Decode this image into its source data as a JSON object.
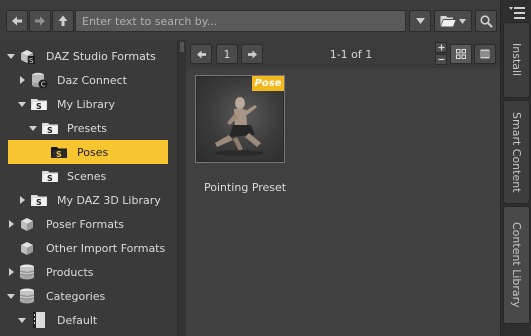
{
  "toolbar": {
    "search_placeholder": "Enter text to search by..."
  },
  "tree": {
    "items": [
      {
        "label": "DAZ Studio Formats",
        "icon": "daz-formats-icon"
      },
      {
        "label": "Daz Connect",
        "icon": "daz-connect-icon"
      },
      {
        "label": "My Library",
        "icon": "library-folder-icon"
      },
      {
        "label": "Presets",
        "icon": "folder-icon"
      },
      {
        "label": "Poses",
        "icon": "folder-icon"
      },
      {
        "label": "Scenes",
        "icon": "folder-icon"
      },
      {
        "label": "My DAZ 3D Library",
        "icon": "library-folder-icon"
      },
      {
        "label": "Poser Formats",
        "icon": "poser-formats-icon"
      },
      {
        "label": "Other Import Formats",
        "icon": "import-formats-icon"
      },
      {
        "label": "Products",
        "icon": "database-icon"
      },
      {
        "label": "Categories",
        "icon": "database-icon"
      },
      {
        "label": "Default",
        "icon": "category-book-icon"
      }
    ],
    "selected": "Poses"
  },
  "content": {
    "page_number": "1",
    "page_info": "1-1 of 1",
    "items": [
      {
        "label": "Pointing Preset",
        "badge": "Pose"
      }
    ]
  },
  "side_tabs": {
    "install": "Install",
    "smart_content": "Smart Content",
    "content_library": "Content Library"
  },
  "colors": {
    "selected_bg": "#f7c530",
    "badge_bg": "#f2b81c",
    "panel_bg": "#3a3a3a"
  }
}
